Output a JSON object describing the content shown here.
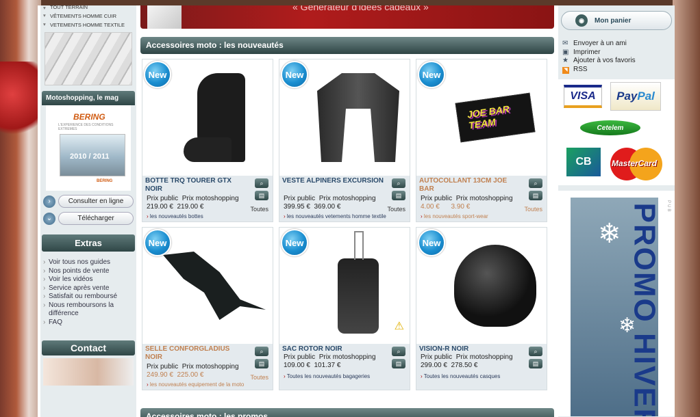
{
  "left": {
    "categories": [
      "TOUT TERRAIN",
      "VÊTEMENTS HOMME CUIR",
      "VETEMENTS HOMME TEXTILE"
    ],
    "mag_title": "Motoshopping, le mag",
    "mag_brand": "BERING",
    "mag_brand_sub": "L'EXPERIENCE DES CONDITIONS EXTREMES",
    "mag_year": "2010 / 2011",
    "btn_consulter": "Consulter en ligne",
    "btn_telecharger": "Télécharger",
    "extras_title": "Extras",
    "extras": [
      "Voir tous nos guides",
      "Nos points de vente",
      "Voir les vidéos",
      "Service après vente",
      "Satisfait ou remboursé",
      "Nous remboursons la différence",
      "FAQ"
    ],
    "contact_title": "Contact"
  },
  "center": {
    "banner_text": "« Générateur d'idées cadeaux »",
    "section_title": "Accessoires moto : les nouveautés",
    "section2_title": "Accessoires moto : les promos",
    "new_label": "New",
    "label_public": "Prix public",
    "label_moto": "Prix motoshopping",
    "products": [
      {
        "title": "BOTTE TRQ TOURER GTX NOIR",
        "public": "219.00 €",
        "moto": "219.00 €",
        "toutes": "Toutes",
        "link": "les nouveautés bottes",
        "icon": "boot-icon"
      },
      {
        "title": "VESTE ALPINERS EXCURSION",
        "public": "399.95 €",
        "moto": "369.00 €",
        "toutes": "Toutes",
        "link": "les nouveautés vetements homme textile",
        "icon": "jacket-icon"
      },
      {
        "title": "AUTOCOLLANT 13CM JOE BAR",
        "public": "4.00 €",
        "moto": "3.90 €",
        "toutes": "Toutes",
        "link": "les nouveautés sport-wear",
        "icon": "sticker-icon",
        "sticker_text": "JOE BAR TEAM"
      },
      {
        "title": "SELLE CONFORGLADIUS NOIR",
        "public": "249.90 €",
        "moto": "225.00 €",
        "toutes": "Toutes",
        "link": "les nouveautés equipement de la moto",
        "icon": "seat-icon"
      },
      {
        "title": "SAC ROTOR NOIR",
        "public": "109.00 €",
        "moto": "101.37 €",
        "toutes": "",
        "link": "Toutes les nouveautés bagageries",
        "icon": "bag-icon"
      },
      {
        "title": "VISION-R NOIR",
        "public": "299.00 €",
        "moto": "278.50 €",
        "toutes": "",
        "link": "Toutes les nouveautés casques",
        "icon": "helmet-icon"
      }
    ]
  },
  "right": {
    "panier": "Mon panier",
    "links": [
      "Envoyer à un ami",
      "Imprimer",
      "Ajouter à vos favoris",
      "RSS"
    ],
    "payments": {
      "visa": "VISA",
      "paypal_a": "Pay",
      "paypal_b": "Pal",
      "cetelem": "Cetelem",
      "cb": "CB",
      "mastercard": "MasterCard"
    },
    "pub": "PUB",
    "promo_text": "PROMO HIVER"
  }
}
